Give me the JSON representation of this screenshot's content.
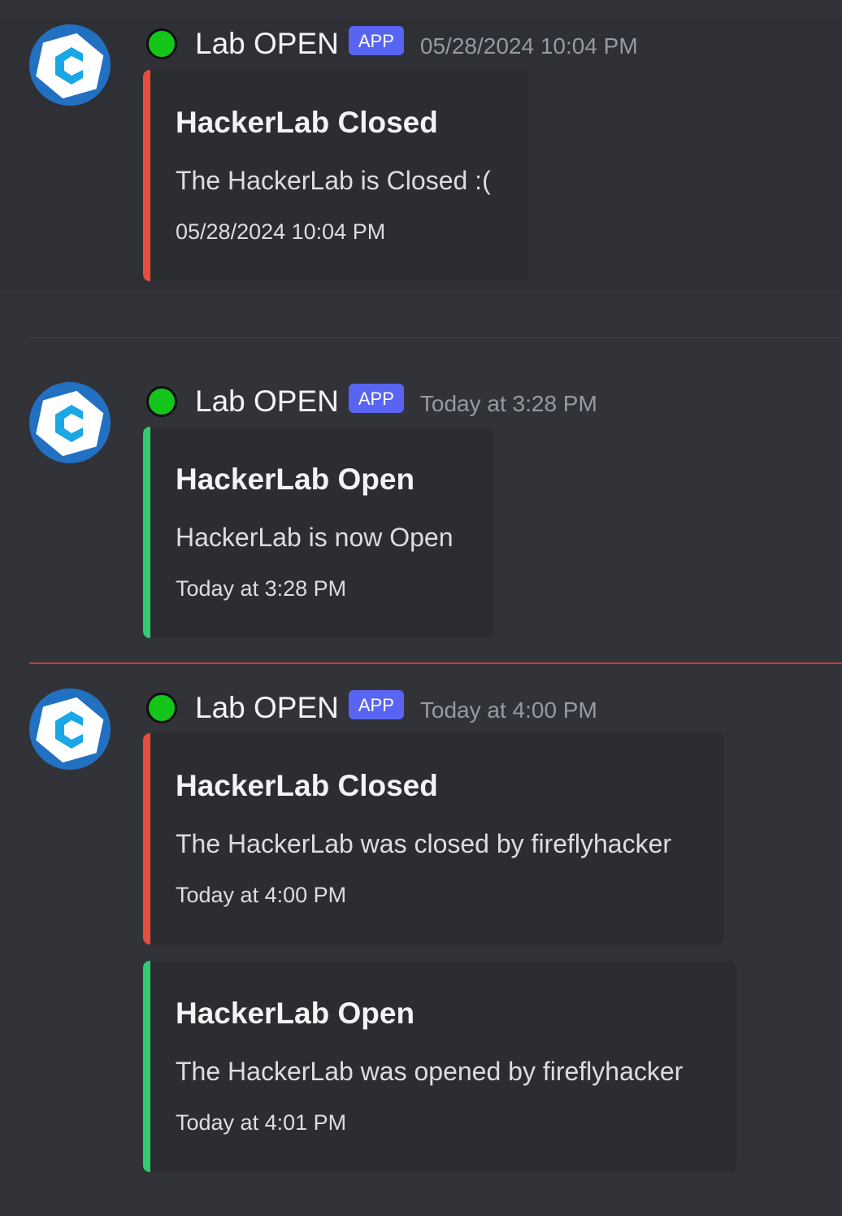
{
  "colors": {
    "background": "#313338",
    "embed_background": "#2b2d31",
    "closed_bar": "#e74c3c",
    "open_bar": "#2ecc71",
    "app_badge": "#5865f2",
    "status_online": "#14c51a",
    "new_messages_divider": "#c93a3f",
    "avatar_blue": "#2270c1",
    "avatar_cyan": "#19a7e6"
  },
  "messages": [
    {
      "username": "Lab OPEN",
      "badge": "APP",
      "timestamp": "05/28/2024 10:04 PM",
      "avatar_icon": "c-logo-icon",
      "status_icon": "online-status-icon",
      "embeds": [
        {
          "status": "closed",
          "title": "HackerLab Closed",
          "description": "The HackerLab is Closed :(",
          "footer": "05/28/2024 10:04 PM"
        }
      ]
    },
    {
      "username": "Lab OPEN",
      "badge": "APP",
      "timestamp": "Today at 3:28 PM",
      "avatar_icon": "c-logo-icon",
      "status_icon": "online-status-icon",
      "embeds": [
        {
          "status": "open",
          "title": "HackerLab Open",
          "description": "HackerLab is now Open",
          "footer": "Today at 3:28 PM"
        }
      ]
    },
    {
      "username": "Lab OPEN",
      "badge": "APP",
      "timestamp": "Today at 4:00 PM",
      "avatar_icon": "c-logo-icon",
      "status_icon": "online-status-icon",
      "embeds": [
        {
          "status": "closed",
          "title": "HackerLab Closed",
          "description": "The HackerLab was closed by fireflyhacker",
          "footer": "Today at 4:00 PM"
        },
        {
          "status": "open",
          "title": "HackerLab Open",
          "description": "The HackerLab was opened by fireflyhacker",
          "footer": "Today at 4:01 PM"
        }
      ]
    }
  ]
}
